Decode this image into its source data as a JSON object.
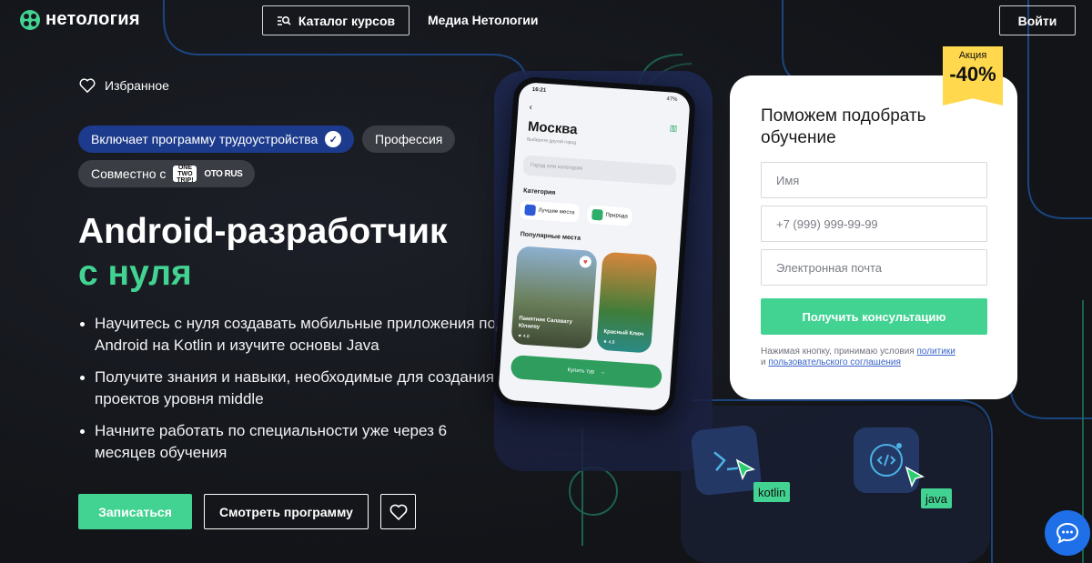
{
  "header": {
    "logo_text": "нетология",
    "catalog_label": "Каталог курсов",
    "media_label": "Медиа Нетологии",
    "login_label": "Войти"
  },
  "hero": {
    "favorites_label": "Избранное",
    "tags": {
      "employment": "Включает программу трудоустройства",
      "profession": "Профессия",
      "partners": "Совместно с",
      "partner1": "ONE TWO TRIP!",
      "partner2": "OTO RUS"
    },
    "title_line1": "Android-разработчик",
    "title_line2": "с нуля",
    "bullets": [
      "Научитесь с нуля создавать мобильные приложения под Android на Kotlin и изучите основы Java",
      "Получите знания и навыки, необходимые для создания проектов уровня middle",
      "Начните работать по специальности уже через 6 месяцев обучения"
    ],
    "enroll_label": "Записаться",
    "program_label": "Смотреть программу"
  },
  "phone": {
    "time": "16:21",
    "battery": "47%",
    "city": "Москва",
    "city_sub": "Выберите другой город",
    "search_placeholder": "Город или категория",
    "categories_title": "Категория",
    "chip1": "Лучшие места",
    "chip2": "Природа",
    "popular_title": "Популярные места",
    "card1_title": "Памятник Салавату Юлаеву",
    "card1_rating": "4.8",
    "card2_title": "Красный Ключ",
    "card2_rating": "4.8",
    "buy_label": "Купить тур"
  },
  "form": {
    "promo_label": "Акция",
    "promo_value": "-40%",
    "title": "Поможем подобрать обучение",
    "name_placeholder": "Имя",
    "phone_placeholder": "+7 (999) 999-99-99",
    "email_placeholder": "Электронная почта",
    "submit_label": "Получить консультацию",
    "agree_prefix": "Нажимая кнопку, принимаю условия",
    "agree_link1": "политики",
    "agree_and": "и",
    "agree_link2": "пользовательского соглашения"
  },
  "tiles": {
    "kotlin_label": "kotlin",
    "java_label": "java"
  },
  "colors": {
    "accent_green": "#42d392",
    "badge_blue": "#1d3b8c",
    "promo_yellow": "#ffd84d",
    "chat_blue": "#1e6fe8"
  },
  "icons": [
    "logo-icon",
    "catalog-search-icon",
    "heart-icon",
    "verified-check-icon",
    "chat-icon",
    "code-icon",
    "cursor-icon"
  ]
}
